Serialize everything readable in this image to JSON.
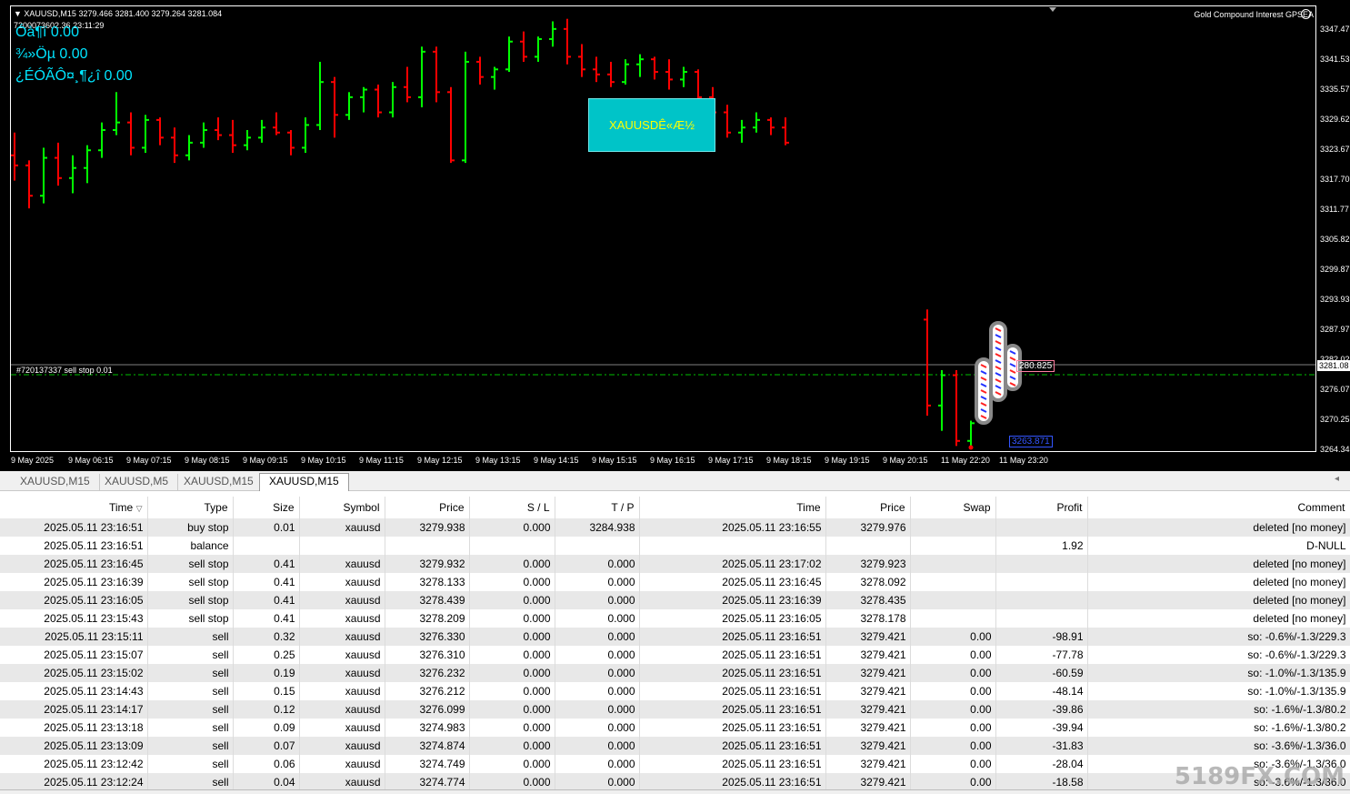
{
  "chart": {
    "symbol_header": "XAUUSD,M15  3279.466 3281.400 3279.264 3281.084",
    "account_line": "7200073602.36      23:11:29",
    "info_lines": [
      "Óà¶ï 0.00",
      "¾»Öµ 0.00",
      "¿ÉÓÃÔ¤¸¶¿î 0.00"
    ],
    "ea_name": "Gold Compound Interest GPSEA",
    "button_label": "XAUUSDÊ«Æ½",
    "order_label": "#720137337 sell stop 0.01",
    "current_price": "3281.08",
    "tag_upper": "280.825",
    "tag_lower": "3263.871",
    "price_ticks": [
      "3347.47",
      "3341.53",
      "3335.57",
      "3329.62",
      "3323.67",
      "3317.70",
      "3311.77",
      "3305.82",
      "3299.87",
      "3293.93",
      "3287.97",
      "3282.02",
      "3276.07",
      "3270.25",
      "3264.34"
    ],
    "time_ticks": [
      "9 May 2025",
      "9 May 06:15",
      "9 May 07:15",
      "9 May 08:15",
      "9 May 09:15",
      "9 May 10:15",
      "9 May 11:15",
      "9 May 12:15",
      "9 May 13:15",
      "9 May 14:15",
      "9 May 15:15",
      "9 May 16:15",
      "9 May 17:15",
      "9 May 18:15",
      "9 May 19:15",
      "9 May 20:15",
      "11 May 22:20",
      "11 May 23:20"
    ],
    "colors": {
      "up": "#00ff00",
      "down": "#ff0000",
      "background": "#000000",
      "accent": "#00c4c8"
    },
    "bars": [
      [
        3322.5,
        3327.0,
        3317.5,
        3320.5
      ],
      [
        3320.5,
        3321.5,
        3312.0,
        3314.5
      ],
      [
        3314.5,
        3324.0,
        3313.0,
        3322.0
      ],
      [
        3322.0,
        3325.0,
        3316.5,
        3318.0
      ],
      [
        3318.0,
        3322.5,
        3315.0,
        3320.0
      ],
      [
        3320.0,
        3324.5,
        3317.0,
        3323.5
      ],
      [
        3323.5,
        3329.0,
        3322.0,
        3327.5
      ],
      [
        3327.5,
        3335.0,
        3326.5,
        3329.0
      ],
      [
        3329.0,
        3331.0,
        3322.5,
        3324.0
      ],
      [
        3324.0,
        3330.5,
        3323.0,
        3329.5
      ],
      [
        3329.5,
        3330.0,
        3324.5,
        3326.0
      ],
      [
        3326.0,
        3328.0,
        3321.0,
        3322.5
      ],
      [
        3322.5,
        3326.5,
        3321.5,
        3325.0
      ],
      [
        3325.0,
        3329.0,
        3324.0,
        3327.5
      ],
      [
        3327.5,
        3330.0,
        3325.5,
        3326.5
      ],
      [
        3326.5,
        3329.5,
        3323.0,
        3324.5
      ],
      [
        3324.5,
        3327.5,
        3323.5,
        3326.0
      ],
      [
        3326.0,
        3329.5,
        3325.0,
        3328.0
      ],
      [
        3328.0,
        3331.0,
        3326.5,
        3327.0
      ],
      [
        3327.0,
        3327.5,
        3322.5,
        3324.0
      ],
      [
        3324.0,
        3330.0,
        3323.0,
        3328.5
      ],
      [
        3328.5,
        3341.0,
        3327.5,
        3337.0
      ],
      [
        3337.0,
        3338.0,
        3326.0,
        3330.5
      ],
      [
        3330.5,
        3335.0,
        3329.5,
        3334.0
      ],
      [
        3334.0,
        3336.0,
        3331.0,
        3335.5
      ],
      [
        3335.5,
        3336.5,
        3330.0,
        3331.0
      ],
      [
        3331.0,
        3337.0,
        3330.0,
        3336.0
      ],
      [
        3336.0,
        3340.0,
        3333.0,
        3334.0
      ],
      [
        3334.0,
        3344.0,
        3332.0,
        3343.0
      ],
      [
        3343.0,
        3344.0,
        3333.0,
        3335.0
      ],
      [
        3335.0,
        3336.0,
        3321.0,
        3321.5
      ],
      [
        3321.5,
        3343.0,
        3321.0,
        3341.0
      ],
      [
        3341.0,
        3342.0,
        3336.5,
        3338.0
      ],
      [
        3338.0,
        3340.0,
        3335.5,
        3339.5
      ],
      [
        3339.5,
        3346.0,
        3339.0,
        3345.0
      ],
      [
        3345.0,
        3347.0,
        3341.0,
        3342.0
      ],
      [
        3342.0,
        3346.0,
        3341.0,
        3345.5
      ],
      [
        3345.5,
        3349.0,
        3344.0,
        3347.5
      ],
      [
        3347.5,
        3349.5,
        3340.5,
        3342.0
      ],
      [
        3342.0,
        3344.5,
        3338.0,
        3339.5
      ],
      [
        3339.5,
        3342.0,
        3337.0,
        3338.5
      ],
      [
        3338.5,
        3341.0,
        3336.0,
        3337.0
      ],
      [
        3337.0,
        3341.5,
        3336.5,
        3340.5
      ],
      [
        3340.5,
        3342.5,
        3338.0,
        3341.5
      ],
      [
        3341.5,
        3342.0,
        3337.5,
        3339.0
      ],
      [
        3339.0,
        3341.5,
        3335.5,
        3337.5
      ],
      [
        3337.5,
        3340.0,
        3336.0,
        3339.0
      ],
      [
        3339.0,
        3339.5,
        3333.0,
        3334.0
      ],
      [
        3334.0,
        3336.0,
        3330.5,
        3331.0
      ],
      [
        3331.0,
        3332.5,
        3326.0,
        3327.0
      ],
      [
        3327.0,
        3329.5,
        3325.0,
        3328.0
      ],
      [
        3328.0,
        3331.0,
        3327.0,
        3329.5
      ],
      [
        3329.5,
        3330.0,
        3326.5,
        3328.0
      ],
      [
        3328.0,
        3330.0,
        3324.5,
        3325.0
      ]
    ],
    "session_bars": [
      [
        3290.0,
        3292.0,
        3271.0,
        3273.0
      ],
      [
        3273.0,
        3280.0,
        3268.0,
        3279.0
      ],
      [
        3279.0,
        3280.0,
        3265.0,
        3266.0
      ],
      [
        3266.0,
        3270.0,
        3264.5,
        3269.5
      ]
    ]
  },
  "tabs": [
    "XAUUSD,M15",
    "XAUUSD,M5",
    "XAUUSD,M15",
    "XAUUSD,M15"
  ],
  "active_tab": 3,
  "table": {
    "columns": [
      "Time",
      "Type",
      "Size",
      "Symbol",
      "Price",
      "S / L",
      "T / P",
      "Time",
      "Price",
      "Swap",
      "Profit",
      "Comment"
    ],
    "sort_icon": "▽",
    "rows": [
      [
        "2025.05.11 23:16:51",
        "buy stop",
        "0.01",
        "xauusd",
        "3279.938",
        "0.000",
        "3284.938",
        "2025.05.11 23:16:55",
        "3279.976",
        "",
        "",
        "deleted [no money]"
      ],
      [
        "2025.05.11 23:16:51",
        "balance",
        "",
        "",
        "",
        "",
        "",
        "",
        "",
        "",
        "1.92",
        "D-NULL"
      ],
      [
        "2025.05.11 23:16:45",
        "sell stop",
        "0.41",
        "xauusd",
        "3279.932",
        "0.000",
        "0.000",
        "2025.05.11 23:17:02",
        "3279.923",
        "",
        "",
        "deleted [no money]"
      ],
      [
        "2025.05.11 23:16:39",
        "sell stop",
        "0.41",
        "xauusd",
        "3278.133",
        "0.000",
        "0.000",
        "2025.05.11 23:16:45",
        "3278.092",
        "",
        "",
        "deleted [no money]"
      ],
      [
        "2025.05.11 23:16:05",
        "sell stop",
        "0.41",
        "xauusd",
        "3278.439",
        "0.000",
        "0.000",
        "2025.05.11 23:16:39",
        "3278.435",
        "",
        "",
        "deleted [no money]"
      ],
      [
        "2025.05.11 23:15:43",
        "sell stop",
        "0.41",
        "xauusd",
        "3278.209",
        "0.000",
        "0.000",
        "2025.05.11 23:16:05",
        "3278.178",
        "",
        "",
        "deleted [no money]"
      ],
      [
        "2025.05.11 23:15:11",
        "sell",
        "0.32",
        "xauusd",
        "3276.330",
        "0.000",
        "0.000",
        "2025.05.11 23:16:51",
        "3279.421",
        "0.00",
        "-98.91",
        "so: -0.6%/-1.3/229.3"
      ],
      [
        "2025.05.11 23:15:07",
        "sell",
        "0.25",
        "xauusd",
        "3276.310",
        "0.000",
        "0.000",
        "2025.05.11 23:16:51",
        "3279.421",
        "0.00",
        "-77.78",
        "so: -0.6%/-1.3/229.3"
      ],
      [
        "2025.05.11 23:15:02",
        "sell",
        "0.19",
        "xauusd",
        "3276.232",
        "0.000",
        "0.000",
        "2025.05.11 23:16:51",
        "3279.421",
        "0.00",
        "-60.59",
        "so: -1.0%/-1.3/135.9"
      ],
      [
        "2025.05.11 23:14:43",
        "sell",
        "0.15",
        "xauusd",
        "3276.212",
        "0.000",
        "0.000",
        "2025.05.11 23:16:51",
        "3279.421",
        "0.00",
        "-48.14",
        "so: -1.0%/-1.3/135.9"
      ],
      [
        "2025.05.11 23:14:17",
        "sell",
        "0.12",
        "xauusd",
        "3276.099",
        "0.000",
        "0.000",
        "2025.05.11 23:16:51",
        "3279.421",
        "0.00",
        "-39.86",
        "so: -1.6%/-1.3/80.2"
      ],
      [
        "2025.05.11 23:13:18",
        "sell",
        "0.09",
        "xauusd",
        "3274.983",
        "0.000",
        "0.000",
        "2025.05.11 23:16:51",
        "3279.421",
        "0.00",
        "-39.94",
        "so: -1.6%/-1.3/80.2"
      ],
      [
        "2025.05.11 23:13:09",
        "sell",
        "0.07",
        "xauusd",
        "3274.874",
        "0.000",
        "0.000",
        "2025.05.11 23:16:51",
        "3279.421",
        "0.00",
        "-31.83",
        "so: -3.6%/-1.3/36.0"
      ],
      [
        "2025.05.11 23:12:42",
        "sell",
        "0.06",
        "xauusd",
        "3274.749",
        "0.000",
        "0.000",
        "2025.05.11 23:16:51",
        "3279.421",
        "0.00",
        "-28.04",
        "so: -3.6%/-1.3/36.0"
      ],
      [
        "2025.05.11 23:12:24",
        "sell",
        "0.04",
        "xauusd",
        "3274.774",
        "0.000",
        "0.000",
        "2025.05.11 23:16:51",
        "3279.421",
        "0.00",
        "-18.58",
        "so: -3.6%/-1.3/36.0"
      ]
    ]
  },
  "watermark": "5189FX.COM"
}
